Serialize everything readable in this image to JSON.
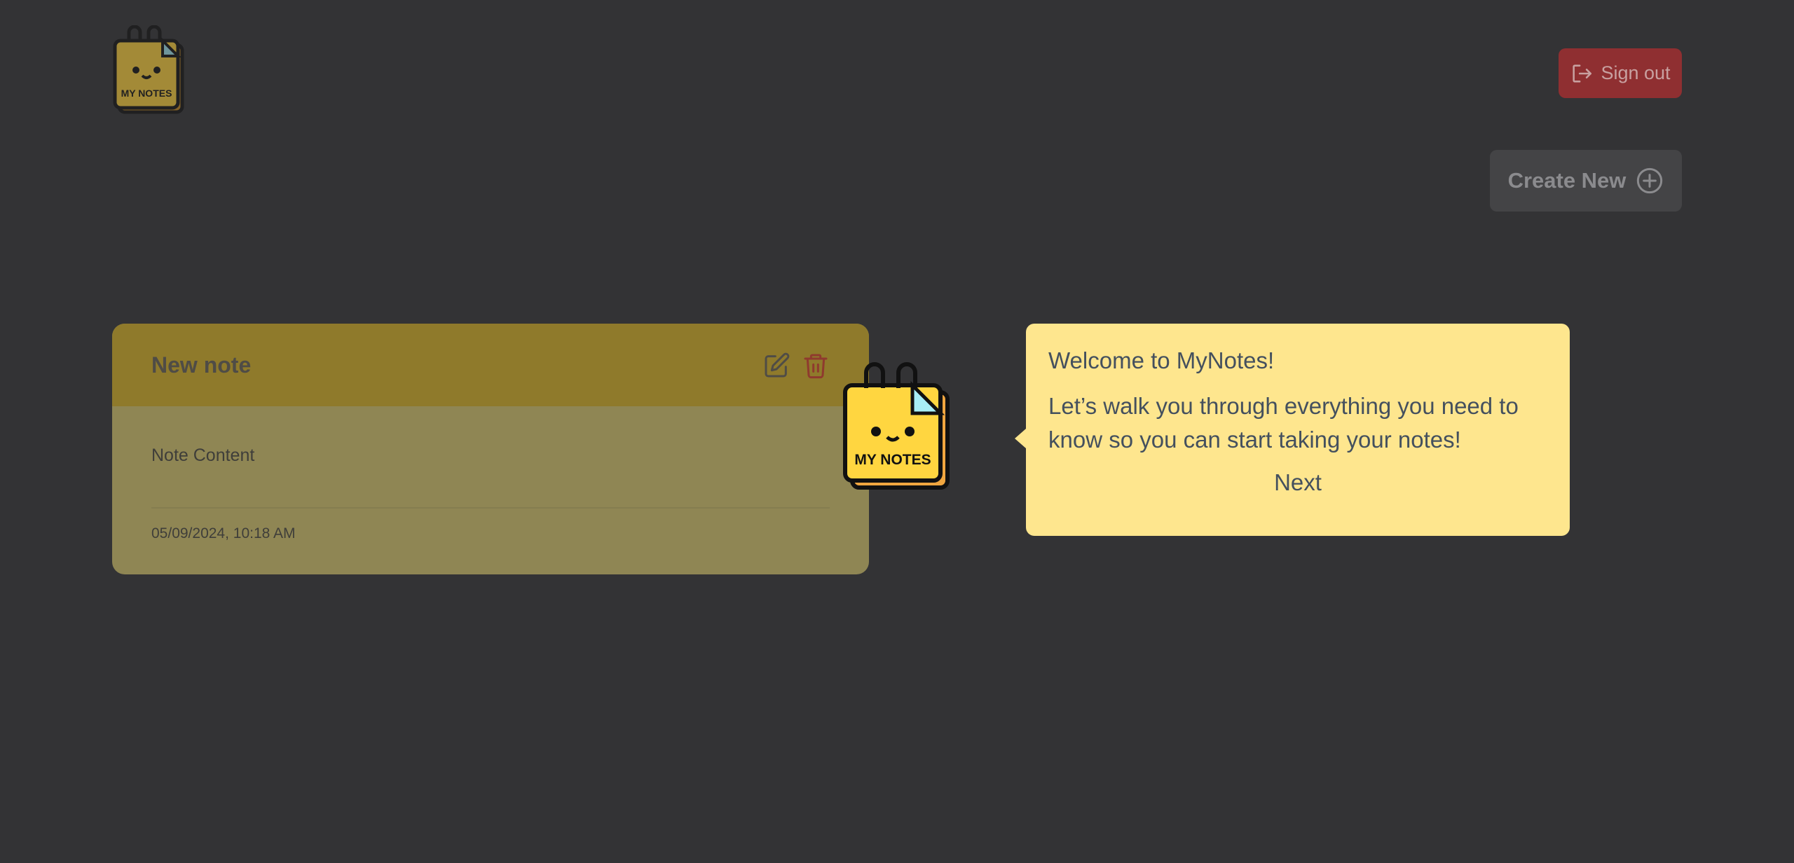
{
  "header": {
    "logo_text": "MY NOTES",
    "signout_label": "Sign out"
  },
  "toolbar": {
    "create_label": "Create New"
  },
  "note": {
    "title": "New note",
    "content": "Note Content",
    "date": "05/09/2024, 10:18 AM"
  },
  "mascot": {
    "text": "MY NOTES"
  },
  "tour": {
    "title": "Welcome to MyNotes!",
    "body": "Let’s walk you through everything you need to know so you can start taking your notes!",
    "next_label": "Next"
  },
  "colors": {
    "background": "#333335",
    "signout": "#8f2f31",
    "tooltip": "#fee68e",
    "note_header": "#8f7a2b",
    "note_body": "#8f8654"
  }
}
